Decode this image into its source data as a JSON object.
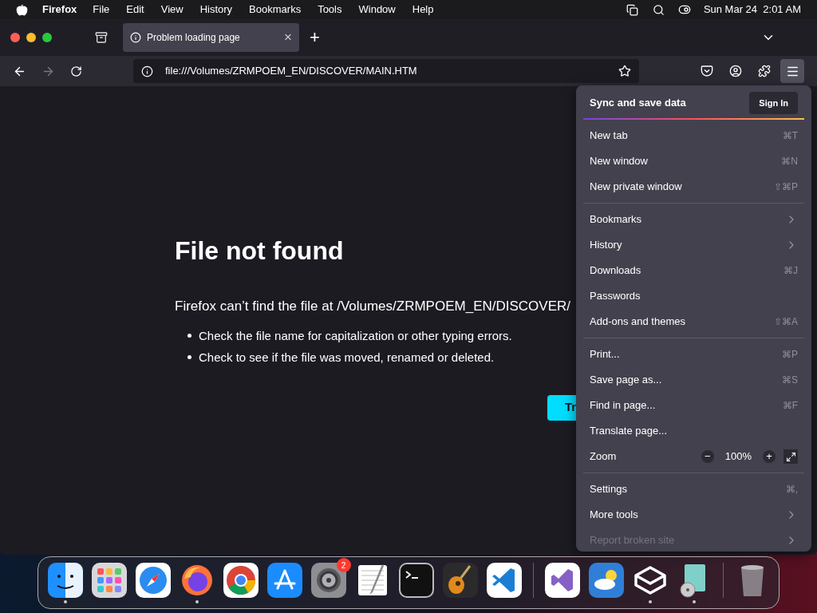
{
  "menu_bar": {
    "app": "Firefox",
    "items": [
      "File",
      "Edit",
      "View",
      "History",
      "Bookmarks",
      "Tools",
      "Window",
      "Help"
    ],
    "clock": "Sun Mar 24  2:01 AM"
  },
  "tabs": [
    {
      "title": "Problem loading page",
      "selected": true,
      "close": "×"
    }
  ],
  "new_tab": "+",
  "address_bar": {
    "url": "file:///Volumes/ZRMPOEM_EN/DISCOVER/MAIN.HTM"
  },
  "page": {
    "title": "File not found",
    "message": "Firefox can’t find the file at /Volumes/ZRMPOEM_EN/DISCOVER/",
    "tips": [
      "Check the file name for capitalization or other typing errors.",
      "Check to see if the file was moved, renamed or deleted."
    ],
    "button": "Tr"
  },
  "app_menu": {
    "header": "Sync and save data",
    "sign_in": "Sign In",
    "items": [
      {
        "kind": "item",
        "label": "New tab",
        "shortcut": "⌘T"
      },
      {
        "kind": "item",
        "label": "New window",
        "shortcut": "⌘N"
      },
      {
        "kind": "item",
        "label": "New private window",
        "shortcut": "⇧⌘P"
      },
      {
        "kind": "separator"
      },
      {
        "kind": "submenu",
        "label": "Bookmarks",
        "disabled": false
      },
      {
        "kind": "submenu",
        "label": "History",
        "disabled": false
      },
      {
        "kind": "item",
        "label": "Downloads",
        "shortcut": "⌘J"
      },
      {
        "kind": "item",
        "label": "Passwords"
      },
      {
        "kind": "item",
        "label": "Add-ons and themes",
        "shortcut": "⇧⌘A"
      },
      {
        "kind": "separator"
      },
      {
        "kind": "item",
        "label": "Print...",
        "shortcut": "⌘P"
      },
      {
        "kind": "item",
        "label": "Save page as...",
        "shortcut": "⌘S"
      },
      {
        "kind": "item",
        "label": "Find in page...",
        "shortcut": "⌘F"
      },
      {
        "kind": "item",
        "label": "Translate page..."
      },
      {
        "kind": "zoom",
        "label": "Zoom",
        "value": "100%",
        "minus": "−",
        "plus": "+"
      },
      {
        "kind": "separator"
      },
      {
        "kind": "item",
        "label": "Settings",
        "shortcut": "⌘,"
      },
      {
        "kind": "submenu",
        "label": "More tools",
        "disabled": false
      },
      {
        "kind": "submenu",
        "label": "Report broken site",
        "disabled": true
      }
    ]
  },
  "dock": [
    {
      "kind": "finder",
      "running": true
    },
    {
      "kind": "launchpad",
      "running": false
    },
    {
      "kind": "safari",
      "running": false
    },
    {
      "kind": "firefox",
      "running": true
    },
    {
      "kind": "chrome",
      "running": false
    },
    {
      "kind": "appstore",
      "running": false
    },
    {
      "kind": "settings",
      "running": false,
      "badge": "2"
    },
    {
      "kind": "textedit",
      "running": false
    },
    {
      "kind": "terminal",
      "running": false
    },
    {
      "kind": "garageband",
      "running": false
    },
    {
      "kind": "vscode",
      "running": false
    },
    {
      "kind": "divider"
    },
    {
      "kind": "visualstudio",
      "running": false
    },
    {
      "kind": "weather",
      "running": false
    },
    {
      "kind": "cube",
      "running": true
    },
    {
      "kind": "installer",
      "running": true
    },
    {
      "kind": "divider"
    },
    {
      "kind": "trash",
      "running": false
    }
  ]
}
